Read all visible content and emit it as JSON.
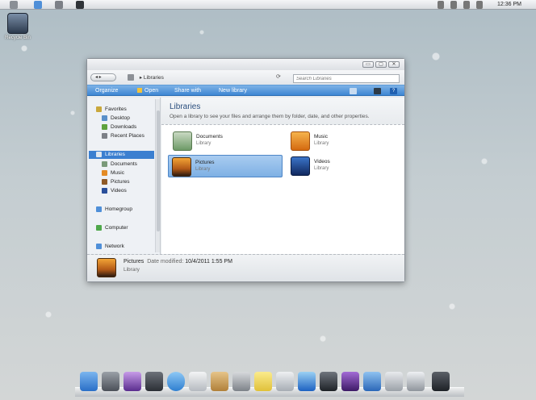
{
  "menubar": {
    "clock": "12:36 PM",
    "icons": [
      "apple-icon",
      "finder-icon",
      "disk-icon",
      "app-icon"
    ]
  },
  "desktop": {
    "recycle_label": "Recycle Bin"
  },
  "window": {
    "controls": [
      "▭",
      "▢",
      "✕"
    ],
    "breadcrumb": "Libraries",
    "search_placeholder": "Search Libraries",
    "toolbar": {
      "organize": "Organize",
      "open": "Open",
      "share_with": "Share with",
      "new_library": "New library"
    },
    "navigation": {
      "favorites": "Favorites",
      "desktop": "Desktop",
      "downloads": "Downloads",
      "recent_places": "Recent Places",
      "libraries": "Libraries",
      "documents": "Documents",
      "music": "Music",
      "pictures": "Pictures",
      "videos": "Videos",
      "homegroup": "Homegroup",
      "computer": "Computer",
      "network": "Network"
    },
    "content": {
      "title": "Libraries",
      "subtitle": "Open a library to see your files and arrange them by folder, date, and other properties.",
      "libraries": [
        {
          "name": "Documents",
          "type": "Library"
        },
        {
          "name": "Music",
          "type": "Library"
        },
        {
          "name": "Pictures",
          "type": "Library"
        },
        {
          "name": "Videos",
          "type": "Library"
        }
      ]
    },
    "details": {
      "name": "Pictures",
      "modified_label": "Date modified:",
      "modified_value": "10/4/2011 1:55 PM",
      "type": "Library"
    }
  },
  "dock": {
    "icons": [
      "finder-icon",
      "system-preferences-icon",
      "photo-icon",
      "dashboard-icon",
      "safari-icon",
      "mail-icon",
      "address-book-icon",
      "calculator-icon",
      "notes-icon",
      "app-store-icon",
      "itunes-icon",
      "quicktime-icon",
      "x-app-icon",
      "xcode-icon",
      "hammer-icon",
      "eject-icon",
      "trash-icon"
    ]
  }
}
